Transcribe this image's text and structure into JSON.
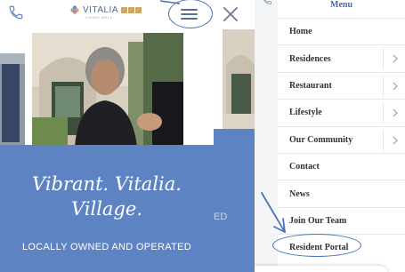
{
  "left_screen": {
    "logo": {
      "text": "VITALIA",
      "subtitle": "LIVING WELL"
    },
    "tagline": [
      "Vibrant. Vitalia.",
      "Village."
    ],
    "subtag": "LOCALLY OWNED AND OPERATED"
  },
  "middle_screen": {
    "peek_text": "ED"
  },
  "menu": {
    "title": "Menu",
    "items": [
      {
        "label": "Home",
        "submenu": false
      },
      {
        "label": "Residences",
        "submenu": true
      },
      {
        "label": "Restaurant",
        "submenu": true
      },
      {
        "label": "Lifestyle",
        "submenu": true
      },
      {
        "label": "Our Community",
        "submenu": true
      },
      {
        "label": "Contact",
        "submenu": false
      },
      {
        "label": "News",
        "submenu": false
      },
      {
        "label": "Join Our Team",
        "submenu": false
      },
      {
        "label": "Resident Portal",
        "submenu": false
      }
    ]
  },
  "colors": {
    "brand_blue": "#5e83c2",
    "annotation_blue": "#4b73b5",
    "menu_title": "#4a6aa8",
    "logo_gold": "#c9a86a"
  },
  "icons": [
    "phone-icon",
    "hamburger-menu-icon",
    "close-icon",
    "chevron-right-icon",
    "annotation-arrow-icon"
  ]
}
